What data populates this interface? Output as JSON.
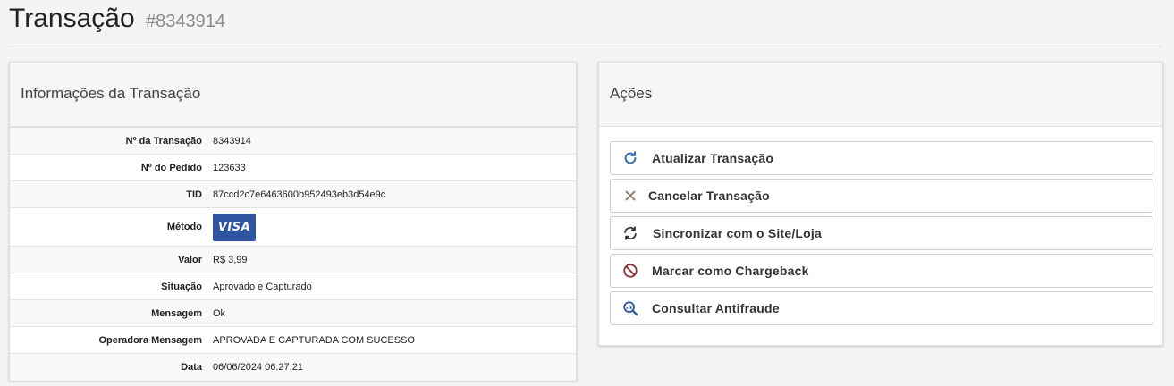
{
  "header": {
    "title": "Transação",
    "transaction_id": "#8343914"
  },
  "info_panel": {
    "heading": "Informações da Transação",
    "rows": [
      {
        "label": "Nº da Transação",
        "value": "8343914"
      },
      {
        "label": "Nº do Pedido",
        "value": "123633"
      },
      {
        "label": "TID",
        "value": "87ccd2c7e6463600b952493eb3d54e9c"
      },
      {
        "label": "Método",
        "value": "VISA"
      },
      {
        "label": "Valor",
        "value": "R$ 3,99"
      },
      {
        "label": "Situação",
        "value": "Aprovado e Capturado"
      },
      {
        "label": "Mensagem",
        "value": "Ok"
      },
      {
        "label": "Operadora Mensagem",
        "value": "APROVADA E CAPTURADA COM SUCESSO"
      },
      {
        "label": "Data",
        "value": "06/06/2024 06:27:21"
      }
    ]
  },
  "actions_panel": {
    "heading": "Ações",
    "buttons": [
      {
        "label": "Atualizar Transação",
        "icon": "refresh-icon",
        "color": "#2f6fb5"
      },
      {
        "label": "Cancelar Transação",
        "icon": "close-icon",
        "color": "#8a7560"
      },
      {
        "label": "Sincronizar com o Site/Loja",
        "icon": "sync-icon",
        "color": "#333333"
      },
      {
        "label": "Marcar como Chargeback",
        "icon": "ban-icon",
        "color": "#8b2e35"
      },
      {
        "label": "Consultar Antifraude",
        "icon": "search-chart-icon",
        "color": "#2a5a9a"
      }
    ]
  },
  "colors": {
    "status_approved": "#4caf50",
    "visa_brand": "#2f54a0"
  }
}
